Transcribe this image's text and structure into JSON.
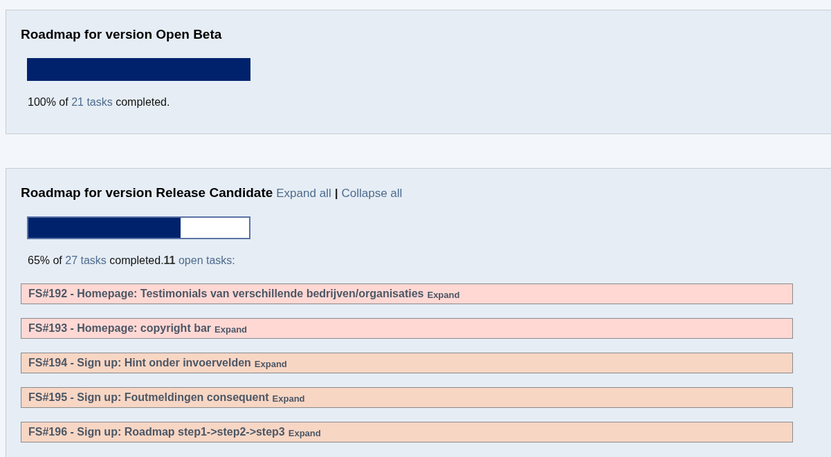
{
  "versions": [
    {
      "title": "Roadmap for version Open Beta",
      "level": 1,
      "summary": {
        "percent": "100% of",
        "tasks_link": "21 tasks",
        "completed": "completed."
      }
    },
    {
      "title": "Roadmap for version Release Candidate",
      "actions": {
        "expand_all": "Expand all",
        "separator": "|",
        "collapse_all": "Collapse all"
      },
      "level": 0.69,
      "summary": {
        "percent": "65% of",
        "tasks_link": "27 tasks",
        "completed": "completed.",
        "open_count": "11",
        "open_link": "open tasks:"
      },
      "tasks": [
        {
          "label": "FS#192 - Homepage: Testimonials van verschillende bedrijven/organisaties",
          "action": "Expand",
          "color": "#ffd8d4"
        },
        {
          "label": "FS#193 - Homepage: copyright bar",
          "action": "Expand",
          "color": "#ffd8d4"
        },
        {
          "label": "FS#194 - Sign up: Hint onder invoervelden",
          "action": "Expand",
          "color": "#f8d6c4"
        },
        {
          "label": "FS#195 - Sign up: Foutmeldingen consequent",
          "action": "Expand",
          "color": "#f8d6c4"
        },
        {
          "label": "FS#196 - Sign up: Roadmap step1->step2->step3",
          "action": "Expand",
          "color": "#f8d6c4"
        }
      ]
    }
  ]
}
